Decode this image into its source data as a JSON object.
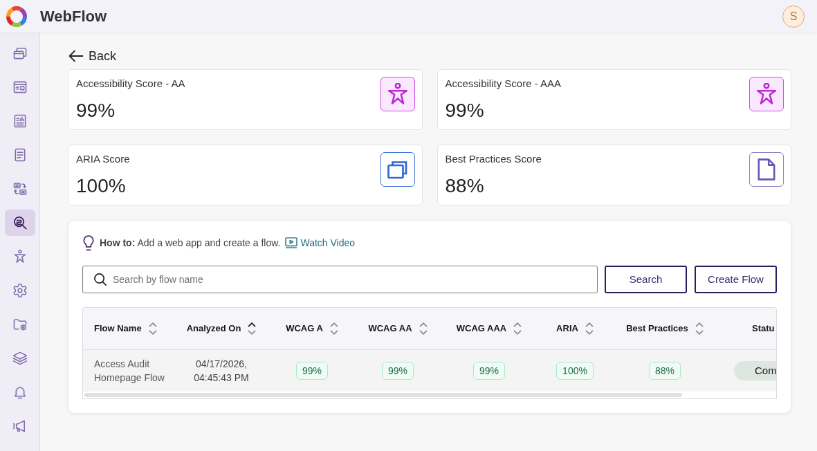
{
  "header": {
    "app_name": "WebFlow",
    "avatar_initial": "S"
  },
  "sidebar": {
    "items": [
      {
        "selected": false
      },
      {
        "selected": false
      },
      {
        "selected": false
      },
      {
        "selected": false
      },
      {
        "selected": false
      },
      {
        "selected": true
      },
      {
        "selected": false
      },
      {
        "selected": false
      },
      {
        "selected": false
      },
      {
        "selected": false
      },
      {
        "selected": false
      },
      {
        "selected": false
      }
    ]
  },
  "back_button": {
    "label": "Back"
  },
  "score_cards": [
    {
      "title": "Accessibility Score - AA",
      "value": "99%"
    },
    {
      "title": "Accessibility Score - AAA",
      "value": "99%"
    },
    {
      "title": "ARIA Score",
      "value": "100%"
    },
    {
      "title": "Best Practices Score",
      "value": "88%"
    }
  ],
  "how_to": {
    "text": "**How to:** Add a web app and create a flow.",
    "link": "Watch Video"
  },
  "search": {
    "placeholder": "Search by flow name",
    "buttons": [
      "Search",
      "Create Flow"
    ]
  },
  "table": {
    "columns": [
      {
        "label": "Flow Name",
        "kind": "text",
        "sorted": false
      },
      {
        "label": "Analyzed On",
        "kind": "date",
        "sorted": true
      },
      {
        "label": "WCAG A",
        "kind": "score",
        "sorted": false
      },
      {
        "label": "WCAG AA",
        "kind": "score",
        "sorted": false
      },
      {
        "label": "WCAG AAA",
        "kind": "score",
        "sorted": false
      },
      {
        "label": "ARIA",
        "kind": "score",
        "sorted": false
      },
      {
        "label": "Best Practices",
        "kind": "score",
        "sorted": false
      },
      {
        "label": "Statu",
        "kind": "status"
      }
    ],
    "rows": [
      {
        "cells": [
          "Access Audit Homepage Flow",
          "04/17/2026, 04:45:43 PM",
          "99%",
          "99%",
          "99%",
          "100%",
          "88%",
          "Com"
        ]
      }
    ]
  }
}
